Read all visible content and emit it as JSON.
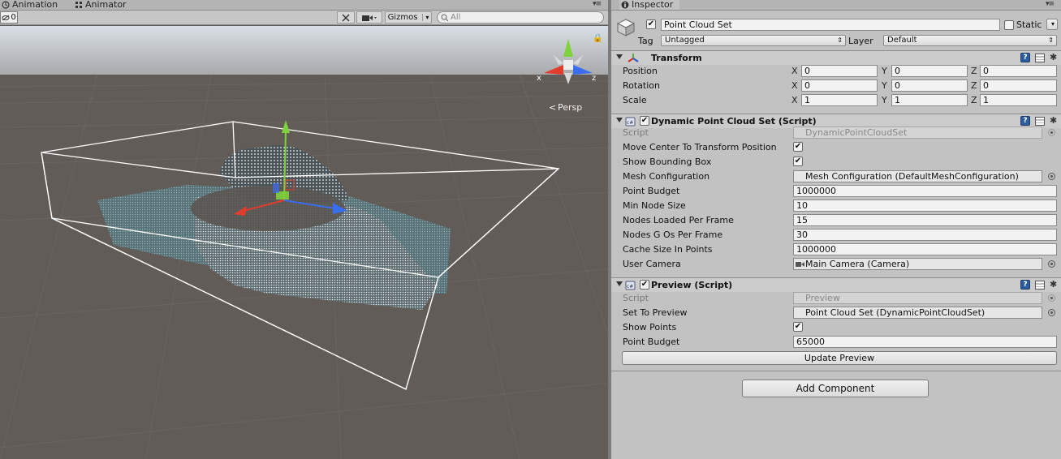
{
  "scene_tabs": [
    {
      "label": "Animation"
    },
    {
      "label": "Animator"
    }
  ],
  "scene_toolbar": {
    "layers_count": "0",
    "gizmos_label": "Gizmos",
    "search_placeholder": "All"
  },
  "scene_view": {
    "axis_x": "x",
    "axis_z": "z",
    "projection_label": "Persp"
  },
  "inspector": {
    "tab_label": "Inspector",
    "object_name": "Point Cloud Set",
    "object_active": true,
    "static_label": "Static",
    "tag_label": "Tag",
    "tag_value": "Untagged",
    "layer_label": "Layer",
    "layer_value": "Default",
    "transform": {
      "title": "Transform",
      "rows": [
        {
          "label": "Position",
          "x": "0",
          "y": "0",
          "z": "0"
        },
        {
          "label": "Rotation",
          "x": "0",
          "y": "0",
          "z": "0"
        },
        {
          "label": "Scale",
          "x": "1",
          "y": "1",
          "z": "1"
        }
      ],
      "axis_x": "X",
      "axis_y": "Y",
      "axis_z": "Z"
    },
    "dynamic": {
      "title": "Dynamic Point Cloud Set (Script)",
      "script_label": "Script",
      "script_value": "DynamicPointCloudSet",
      "move_center_label": "Move Center To Transform Position",
      "show_bbox_label": "Show Bounding Box",
      "mesh_config_label": "Mesh Configuration",
      "mesh_config_value": "Mesh Configuration (DefaultMeshConfiguration)",
      "point_budget_label": "Point Budget",
      "point_budget_value": "1000000",
      "min_node_size_label": "Min Node Size",
      "min_node_size_value": "10",
      "nodes_loaded_label": "Nodes Loaded Per Frame",
      "nodes_loaded_value": "15",
      "nodes_gos_label": "Nodes G Os Per Frame",
      "nodes_gos_value": "30",
      "cache_size_label": "Cache Size In Points",
      "cache_size_value": "1000000",
      "user_camera_label": "User Camera",
      "user_camera_value": "Main Camera (Camera)"
    },
    "preview": {
      "title": "Preview (Script)",
      "script_label": "Script",
      "script_value": "Preview",
      "set_to_preview_label": "Set To Preview",
      "set_to_preview_value": "Point Cloud Set (DynamicPointCloudSet)",
      "show_points_label": "Show Points",
      "point_budget_label": "Point Budget",
      "point_budget_value": "65000",
      "update_button": "Update Preview"
    },
    "add_component_button": "Add Component"
  }
}
